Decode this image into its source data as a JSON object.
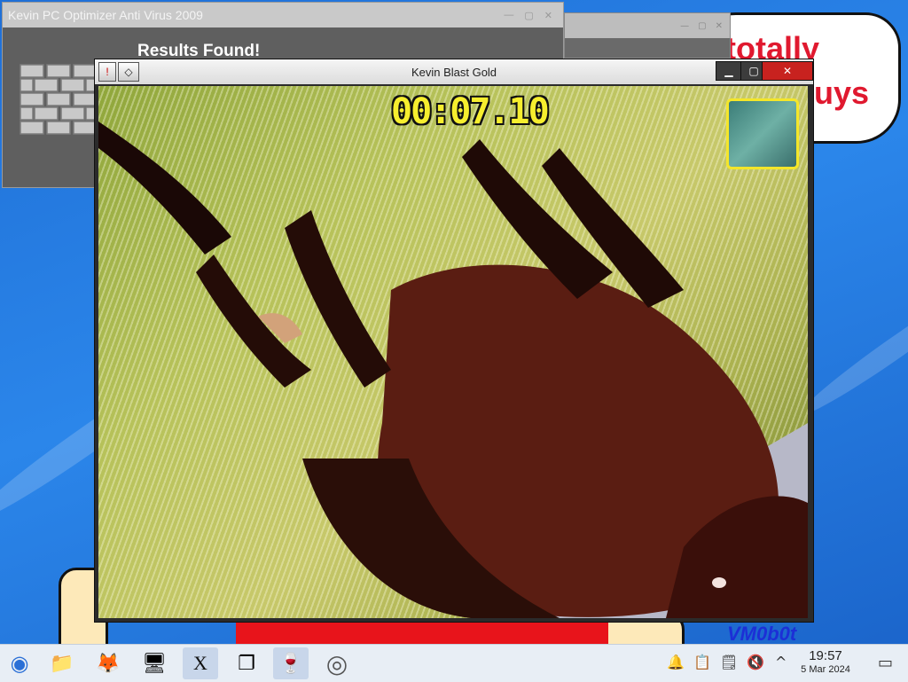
{
  "desktop": {
    "bubble_line1": "totally",
    "bubble_line2": "uys",
    "vm_label": "VM0b0t"
  },
  "optimizer_window": {
    "title": "Kevin PC Optimizer Anti Virus 2009",
    "heading": "Results Found!"
  },
  "game_window": {
    "title": "Kevin Blast Gold",
    "timer": "00:07.10",
    "accent_timer": "#f6ee2e",
    "accent_minimap_border": "#f4e62a"
  },
  "taskbar": {
    "apps": [
      {
        "name": "start-menu-icon",
        "glyph": "◉"
      },
      {
        "name": "file-manager-icon",
        "glyph": "📁"
      },
      {
        "name": "firefox-icon",
        "glyph": "🦊"
      },
      {
        "name": "system-settings-icon",
        "glyph": "🖥"
      },
      {
        "name": "x-app-icon",
        "glyph": "X"
      },
      {
        "name": "window-switcher-icon",
        "glyph": "❐"
      },
      {
        "name": "wine-glass-icon",
        "glyph": "🍷"
      },
      {
        "name": "compass-app-icon",
        "glyph": "◎"
      }
    ],
    "tray": {
      "notifications_icon": "🔔",
      "clipboard_icon": "📋",
      "clipboard2_icon": "🗒",
      "volume_muted_icon": "🔇",
      "expand_icon": "^"
    },
    "clock_time": "19:57",
    "clock_date": "5 Mar 2024",
    "show_desktop_icon": "▭"
  }
}
